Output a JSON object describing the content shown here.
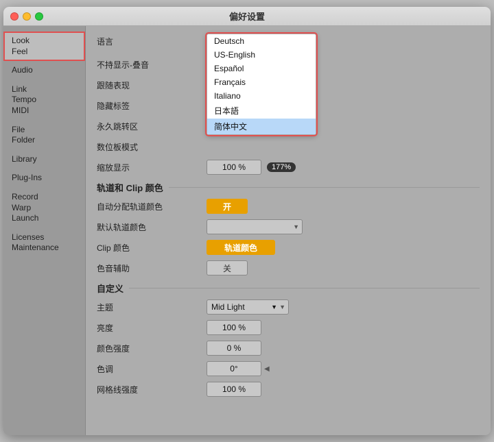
{
  "window": {
    "title": "偏好设置"
  },
  "sidebar": {
    "items": [
      {
        "id": "look-feel",
        "label": "Look\nFeel",
        "active": true
      },
      {
        "id": "audio",
        "label": "Audio",
        "active": false
      },
      {
        "id": "link-tempo-midi",
        "label": "Link\nTempo\nMIDI",
        "active": false
      },
      {
        "id": "file-folder",
        "label": "File\nFolder",
        "active": false
      },
      {
        "id": "library",
        "label": "Library",
        "active": false
      },
      {
        "id": "plug-ins",
        "label": "Plug-Ins",
        "active": false
      },
      {
        "id": "record-warp-launch",
        "label": "Record\nWarp\nLaunch",
        "active": false
      },
      {
        "id": "licenses-maintenance",
        "label": "Licenses\nMaintenance",
        "active": false
      }
    ]
  },
  "main": {
    "language_label": "语言",
    "language_current": "简体中文",
    "language_options": [
      {
        "value": "Deutsch",
        "selected": false
      },
      {
        "value": "US-English",
        "selected": false
      },
      {
        "value": "Español",
        "selected": false
      },
      {
        "value": "Français",
        "selected": false
      },
      {
        "value": "Italiano",
        "selected": false
      },
      {
        "value": "日本語",
        "selected": false
      },
      {
        "value": "简体中文",
        "selected": true
      }
    ],
    "row_display_label": "不持显示-叠音",
    "row_follow_label": "跟随表现",
    "row_hide_tags_label": "隐藏标签",
    "row_permanent_warp_label": "永久跳转区",
    "row_tablet_label": "数位板模式",
    "row_zoom_label": "缩放显示",
    "row_zoom_value": "100 %",
    "section_track_clip": "轨道和 Clip 颜色",
    "row_auto_color_label": "自动分配轨道颜色",
    "row_auto_color_value": "开",
    "row_default_color_label": "默认轨道颜色",
    "row_clip_color_label": "Clip 颜色",
    "row_clip_color_value": "轨道颜色",
    "row_color_assist_label": "色音辅助",
    "row_color_assist_value": "关",
    "section_custom": "自定义",
    "row_theme_label": "主题",
    "row_theme_value": "Mid Light",
    "row_brightness_label": "亮度",
    "row_brightness_value": "100 %",
    "row_color_intensity_label": "颜色强度",
    "row_color_intensity_value": "0 %",
    "row_hue_label": "色调",
    "row_hue_value": "0°",
    "row_grid_label": "网格线强度",
    "row_grid_value": "100 %",
    "tooltip_zoom": "177%"
  }
}
